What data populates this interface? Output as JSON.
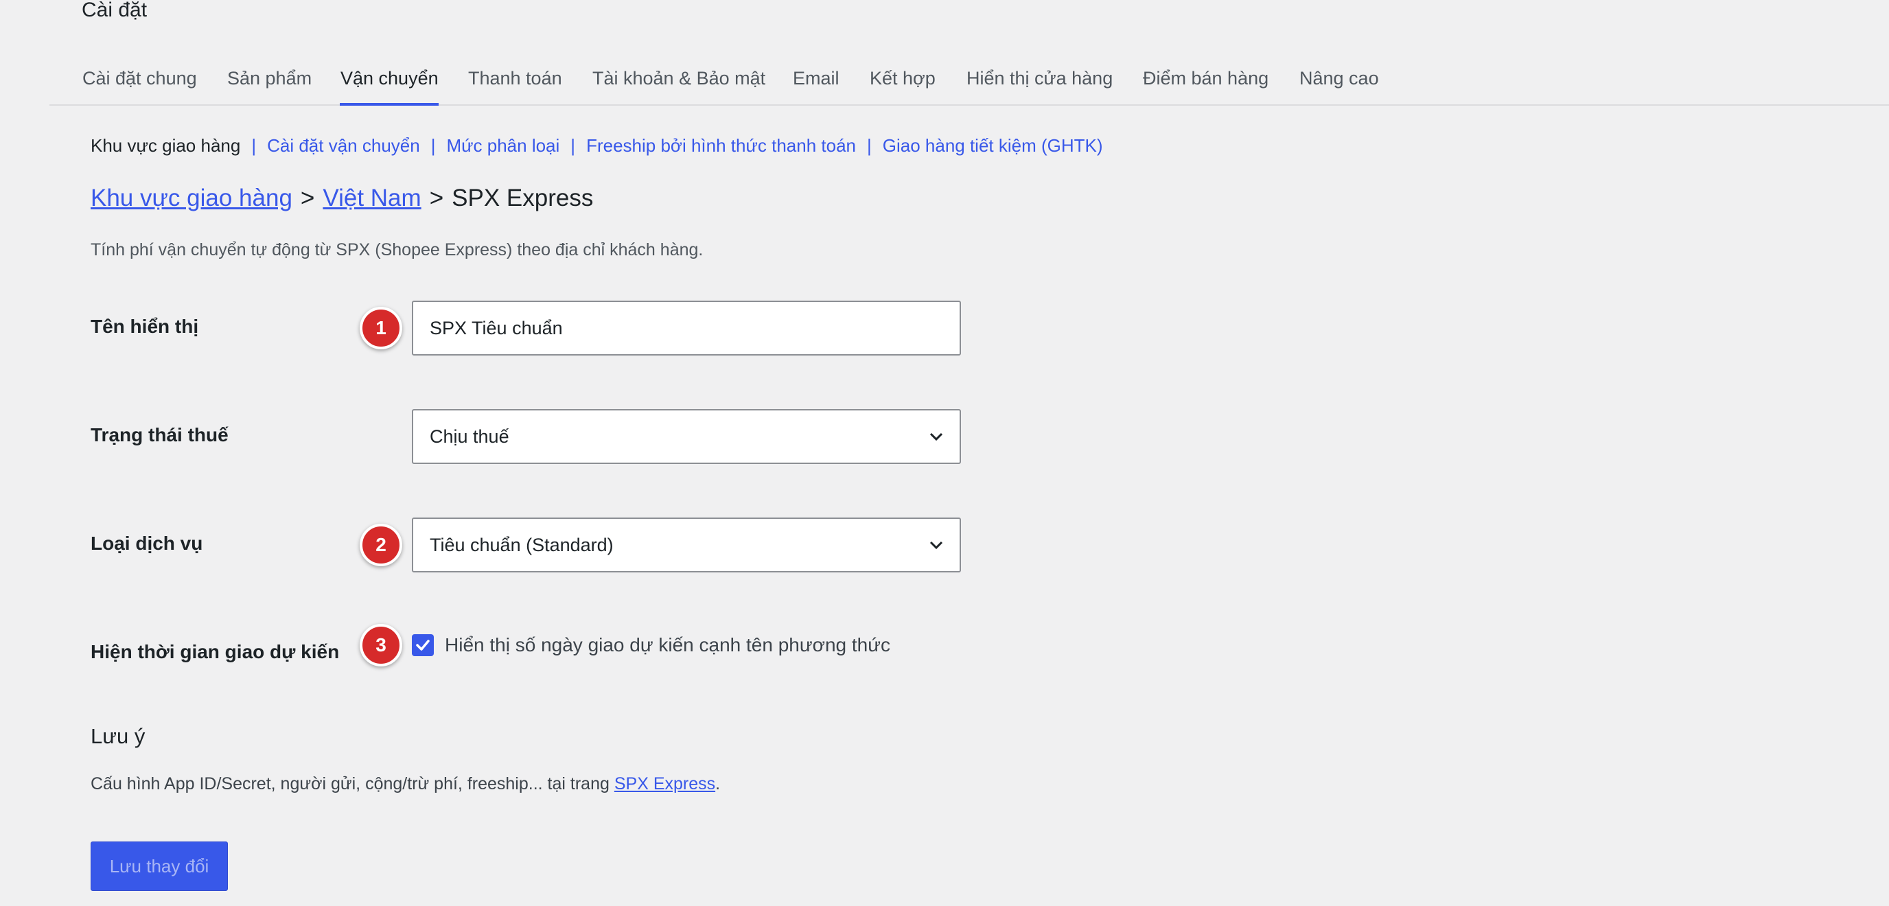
{
  "page_title": "Cài đặt",
  "tabs": [
    {
      "label": "Cài đặt chung"
    },
    {
      "label": "Sản phẩm"
    },
    {
      "label": "Vận chuyển",
      "active": true
    },
    {
      "label": "Thanh toán"
    },
    {
      "label": "Tài khoản & Bảo mật"
    },
    {
      "label": "Email"
    },
    {
      "label": "Kết hợp"
    },
    {
      "label": "Hiển thị cửa hàng"
    },
    {
      "label": "Điểm bán hàng"
    },
    {
      "label": "Nâng cao"
    }
  ],
  "subnav": {
    "current": "Khu vực giao hàng",
    "separator": "|",
    "links": [
      "Cài đặt vận chuyển",
      "Mức phân loại",
      "Freeship bởi hình thức thanh toán",
      "Giao hàng tiết kiệm (GHTK)"
    ]
  },
  "breadcrumb": {
    "crumb1": "Khu vực giao hàng",
    "crumb2": "Việt Nam",
    "current": "SPX Express",
    "separator": ">"
  },
  "description": "Tính phí vận chuyển tự động từ SPX (Shopee Express) theo địa chỉ khách hàng.",
  "fields": {
    "display_name": {
      "label": "Tên hiển thị",
      "value": "SPX Tiêu chuẩn"
    },
    "tax_status": {
      "label": "Trạng thái thuế",
      "value": "Chịu thuế"
    },
    "service_type": {
      "label": "Loại dịch vụ",
      "value": "Tiêu chuẩn (Standard)"
    },
    "eta": {
      "label": "Hiện thời gian giao dự kiến",
      "checkbox_label": "Hiển thị số ngày giao dự kiến cạnh tên phương thức",
      "checked": true
    }
  },
  "badges": [
    "1",
    "2",
    "3"
  ],
  "note": {
    "heading": "Lưu ý",
    "text_before": "Cấu hình App ID/Secret, người gửi, cộng/trừ phí, freeship... tại trang ",
    "link": "SPX Express",
    "text_after": "."
  },
  "save_button": "Lưu thay đổi",
  "colors": {
    "accent": "#3858e9",
    "badge": "#d62a2a",
    "background": "#f0f0f1"
  }
}
